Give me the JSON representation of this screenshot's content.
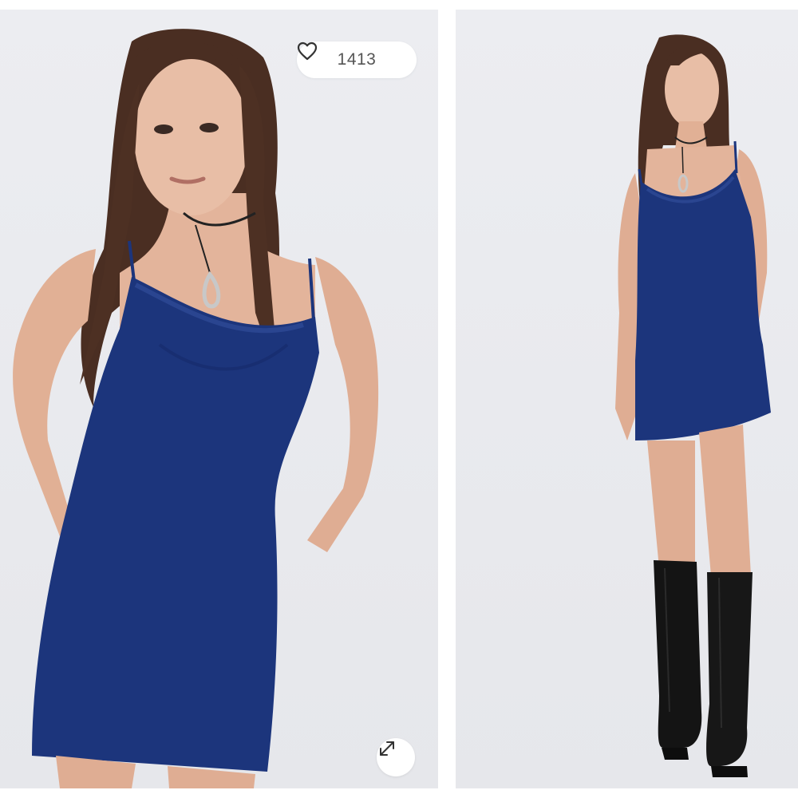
{
  "gallery": {
    "favorites": {
      "count": "1413",
      "icon": "heart-outline-icon"
    },
    "expand": {
      "icon": "expand-diagonal-icon"
    },
    "images": [
      {
        "name": "model-front-closeup"
      },
      {
        "name": "model-full-body"
      }
    ]
  },
  "colors": {
    "background": "#e9eaee",
    "dress": "#1c357c",
    "skin": "#e2b299",
    "hair": "#4a2e22",
    "boots": "#141414",
    "pill_background": "#ffffff",
    "pill_text": "#555555"
  }
}
